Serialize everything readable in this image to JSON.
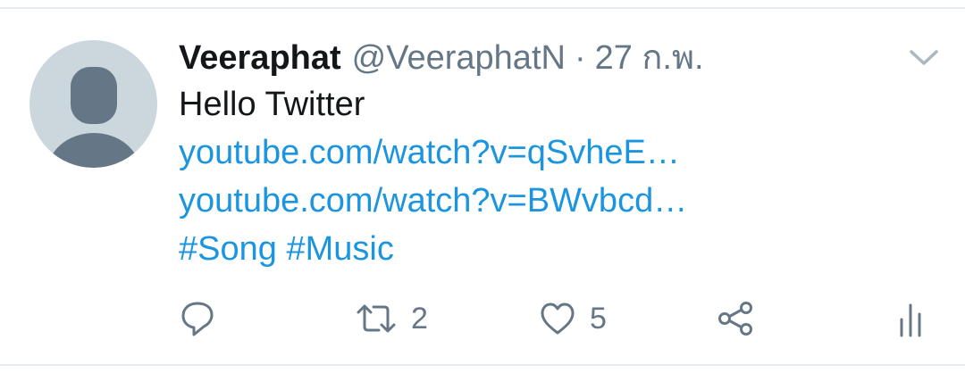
{
  "tweet": {
    "author_name": "Veeraphat",
    "author_handle": "@VeeraphatN",
    "separator": "·",
    "timestamp": "27 ก.พ.",
    "text": "Hello Twitter",
    "links": [
      "youtube.com/watch?v=qSvheE…",
      "youtube.com/watch?v=BWvbcd…"
    ],
    "hashtags": [
      "#Song",
      "#Music"
    ]
  },
  "actions": {
    "reply_icon": "reply-icon",
    "retweet_icon": "retweet-icon",
    "retweet_count": "2",
    "like_icon": "heart-icon",
    "like_count": "5",
    "share_icon": "share-icon",
    "analytics_icon": "analytics-icon"
  },
  "colors": {
    "link": "#1b95e0",
    "text_primary": "#14171a",
    "text_secondary": "#657786",
    "avatar_bg": "#ccd6dd",
    "avatar_figure": "#657786",
    "divider": "#e6ecf0"
  }
}
